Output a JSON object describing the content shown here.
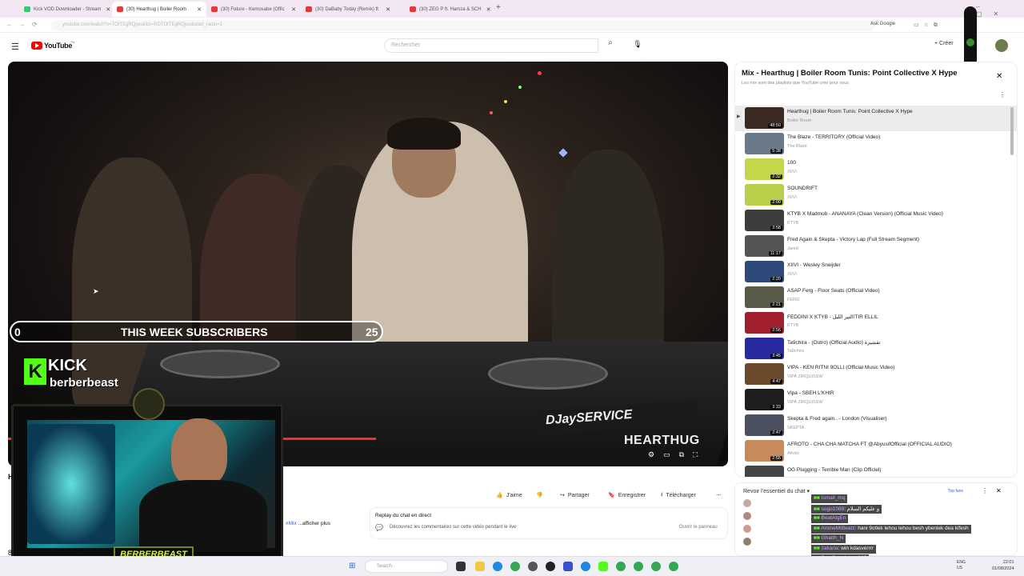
{
  "browser": {
    "tabs": [
      {
        "label": "Kick VOD Downloader - Stream",
        "active": false
      },
      {
        "label": "(30) Hearthug | Boiler Room",
        "active": true
      },
      {
        "label": "(30) Future - Kemosabe (Offic",
        "active": false
      },
      {
        "label": "(30) DaBaby Today (Remix) ft",
        "active": false
      },
      {
        "label": "(30) ZEG P ft. Hamza & SCH",
        "active": false
      }
    ],
    "url": "youtube.com/watch?v=TOtTEgRQjuo&list=RDTOtTEgRQjuo&start_radio=1",
    "ask_google": "Ask Google"
  },
  "youtube": {
    "logo": "YouTube",
    "logo_region": "TN",
    "search_placeholder": "Rechercher",
    "create_label": "Créer",
    "notif_count": "9+"
  },
  "player": {
    "overlay_subs": {
      "left": "0",
      "title": "THIS WEEK SUBSCRIBERS",
      "right": "25"
    },
    "kick_brand": "KICK",
    "kick_user": "berberbeast",
    "watermark": "HEARTHUG",
    "webcam_name": "BERBERBEAST"
  },
  "below": {
    "title_fragment": "He",
    "like": "J'aime",
    "share": "Partager",
    "save": "Enregistrer",
    "download": "Télécharger",
    "desc_link": "#Mix",
    "desc_more": "...afficher plus",
    "comments_count": "80",
    "comments_label": "mentaires",
    "replay_title": "Replay du chat en direct",
    "replay_desc": "Découvrez les commentaires sur cette vidéo pendant le live",
    "replay_btn": "Ouvrir le panneau"
  },
  "playlist": {
    "title": "Mix - Hearthug | Boiler Room Tunis: Point Collective X Hype",
    "subtitle": "Les mix sont des playlists que YouTube crée pour vous",
    "items": [
      {
        "title": "Hearthug | Boiler Room Tunis: Point Collective X Hype",
        "channel": "Boiler Room",
        "duration": "48:50",
        "color": "#3a2a22"
      },
      {
        "title": "The Blaze - TERRITORY (Official Video)",
        "channel": "The Blaze",
        "duration": "5:38",
        "color": "#6b7a88"
      },
      {
        "title": "100",
        "channel": "XIIVI",
        "duration": "2:32",
        "color": "#c6d64a"
      },
      {
        "title": "SOUNDRIFT",
        "channel": "XIIVI",
        "duration": "2:00",
        "color": "#b8cf4a"
      },
      {
        "title": "KTYB X Madmob - ANANAYA (Clean Version) (Official Music Video)",
        "channel": "KTYB",
        "duration": "3:58",
        "color": "#3d3d3d"
      },
      {
        "title": "Fred Again & Skepta - Victory Lap (Full Stream Segment)",
        "channel": "Jared",
        "duration": "11:17",
        "color": "#555"
      },
      {
        "title": "XIIVI - Wesley Sneijder",
        "channel": "XIIVI",
        "duration": "2:20",
        "color": "#2e4a7a"
      },
      {
        "title": "ASAP Ferg - Floor Seats (Official Video)",
        "channel": "FERG",
        "duration": "2:21",
        "color": "#5a5a4a"
      },
      {
        "title": "FEDDINI X KTYB - التير الليل/TIR ELLIL",
        "channel": "KTYB",
        "duration": "2:56",
        "color": "#a02030"
      },
      {
        "title": "Ta9chira - (Outro) (Official Audio) تقشيرة",
        "channel": "Ta9chira",
        "duration": "3:45",
        "color": "#2a2aa0"
      },
      {
        "title": "VIPA - KEN RITNI 9OLLI (Official Music Video)",
        "channel": "VIPA ZIRQUISSW",
        "duration": "4:47",
        "color": "#6a4a2a"
      },
      {
        "title": "Vipa - SBEH L'KHIR",
        "channel": "VIPA ZIRQUISSW",
        "duration": "3:33",
        "color": "#1e1e1e"
      },
      {
        "title": "Skepta & Fred again.. - London (Visualiser)",
        "channel": "SKEPTA",
        "duration": "2:47",
        "color": "#4a5060"
      },
      {
        "title": "AFROTO - CHA CHA MATCHA FT @AbyusifOfficial (OFFICIAL AUDIO)",
        "channel": "Afroto",
        "duration": "2:55",
        "color": "#c88a5a"
      },
      {
        "title": "OG Plugging - Terrible Man (Clip Officiel)",
        "channel": "",
        "duration": "",
        "color": "#444"
      }
    ]
  },
  "chat_panel": {
    "header": "Revoir l'essentiel du chat",
    "top_fan": "Top fans"
  },
  "kick_chat": [
    {
      "user": "Ismail_mq",
      "msg": ""
    },
    {
      "user": "sogo1069",
      "msg": "و عليكم السلام"
    },
    {
      "user": "BeatAlgEn",
      "msg": ""
    },
    {
      "user": "AmineMIBeatz",
      "msg": "hani 9otlek lehou lehou besh ybenlek dea kifesh"
    },
    {
      "user": "Ghaith_N",
      "msg": ""
    },
    {
      "user": "zakaria",
      "msg": "win kdasverrrr"
    },
    {
      "user": "BearBae",
      "msg": "lsayedd ?"
    }
  ],
  "taskbar": {
    "search": "Search",
    "lang": "ENG\nUS",
    "time": "22:01",
    "date": "01/08/2024"
  }
}
